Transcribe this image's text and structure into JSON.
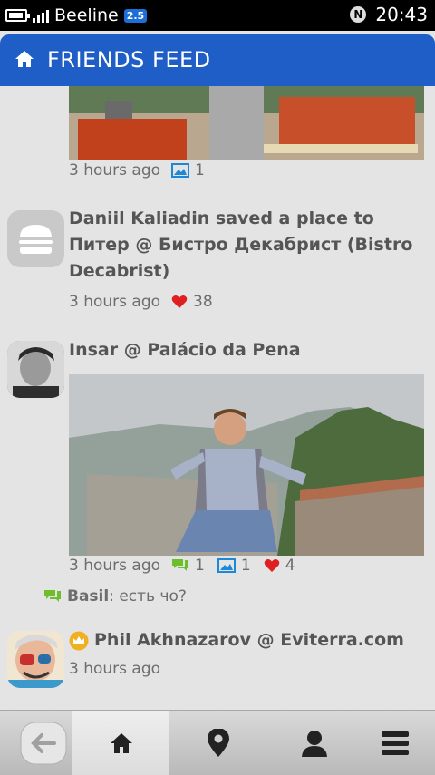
{
  "status": {
    "carrier": "Beeline",
    "network": "2.5",
    "time": "20:43",
    "battery_level": 0.75
  },
  "header": {
    "title": "FRIENDS FEED"
  },
  "feed": [
    {
      "time": "3 hours ago",
      "photos": "1"
    },
    {
      "title": "Daniil Kaliadin saved a place to Питер @ Бистро Декабрист (Bistro Decabrist)",
      "time": "3 hours ago",
      "likes": "38"
    },
    {
      "user": "Insar",
      "venue": "Palácio da Pena",
      "time": "3 hours ago",
      "comments": "1",
      "photos": "1",
      "likes": "4",
      "comment": {
        "author": "Basil",
        "text": ": есть чо?"
      }
    },
    {
      "user": "Phil Akhnazarov",
      "venue": "Eviterra.com",
      "time": "3 hours ago"
    }
  ],
  "colors": {
    "header": "#1f5ec7",
    "photo_icon": "#1e88d8",
    "comment_icon": "#6cbf2a",
    "like_icon": "#e02020",
    "crown": "#f0b020"
  },
  "navbar": [
    "back-icon",
    "home-icon",
    "places-icon",
    "profile-icon",
    "menu-icon"
  ]
}
